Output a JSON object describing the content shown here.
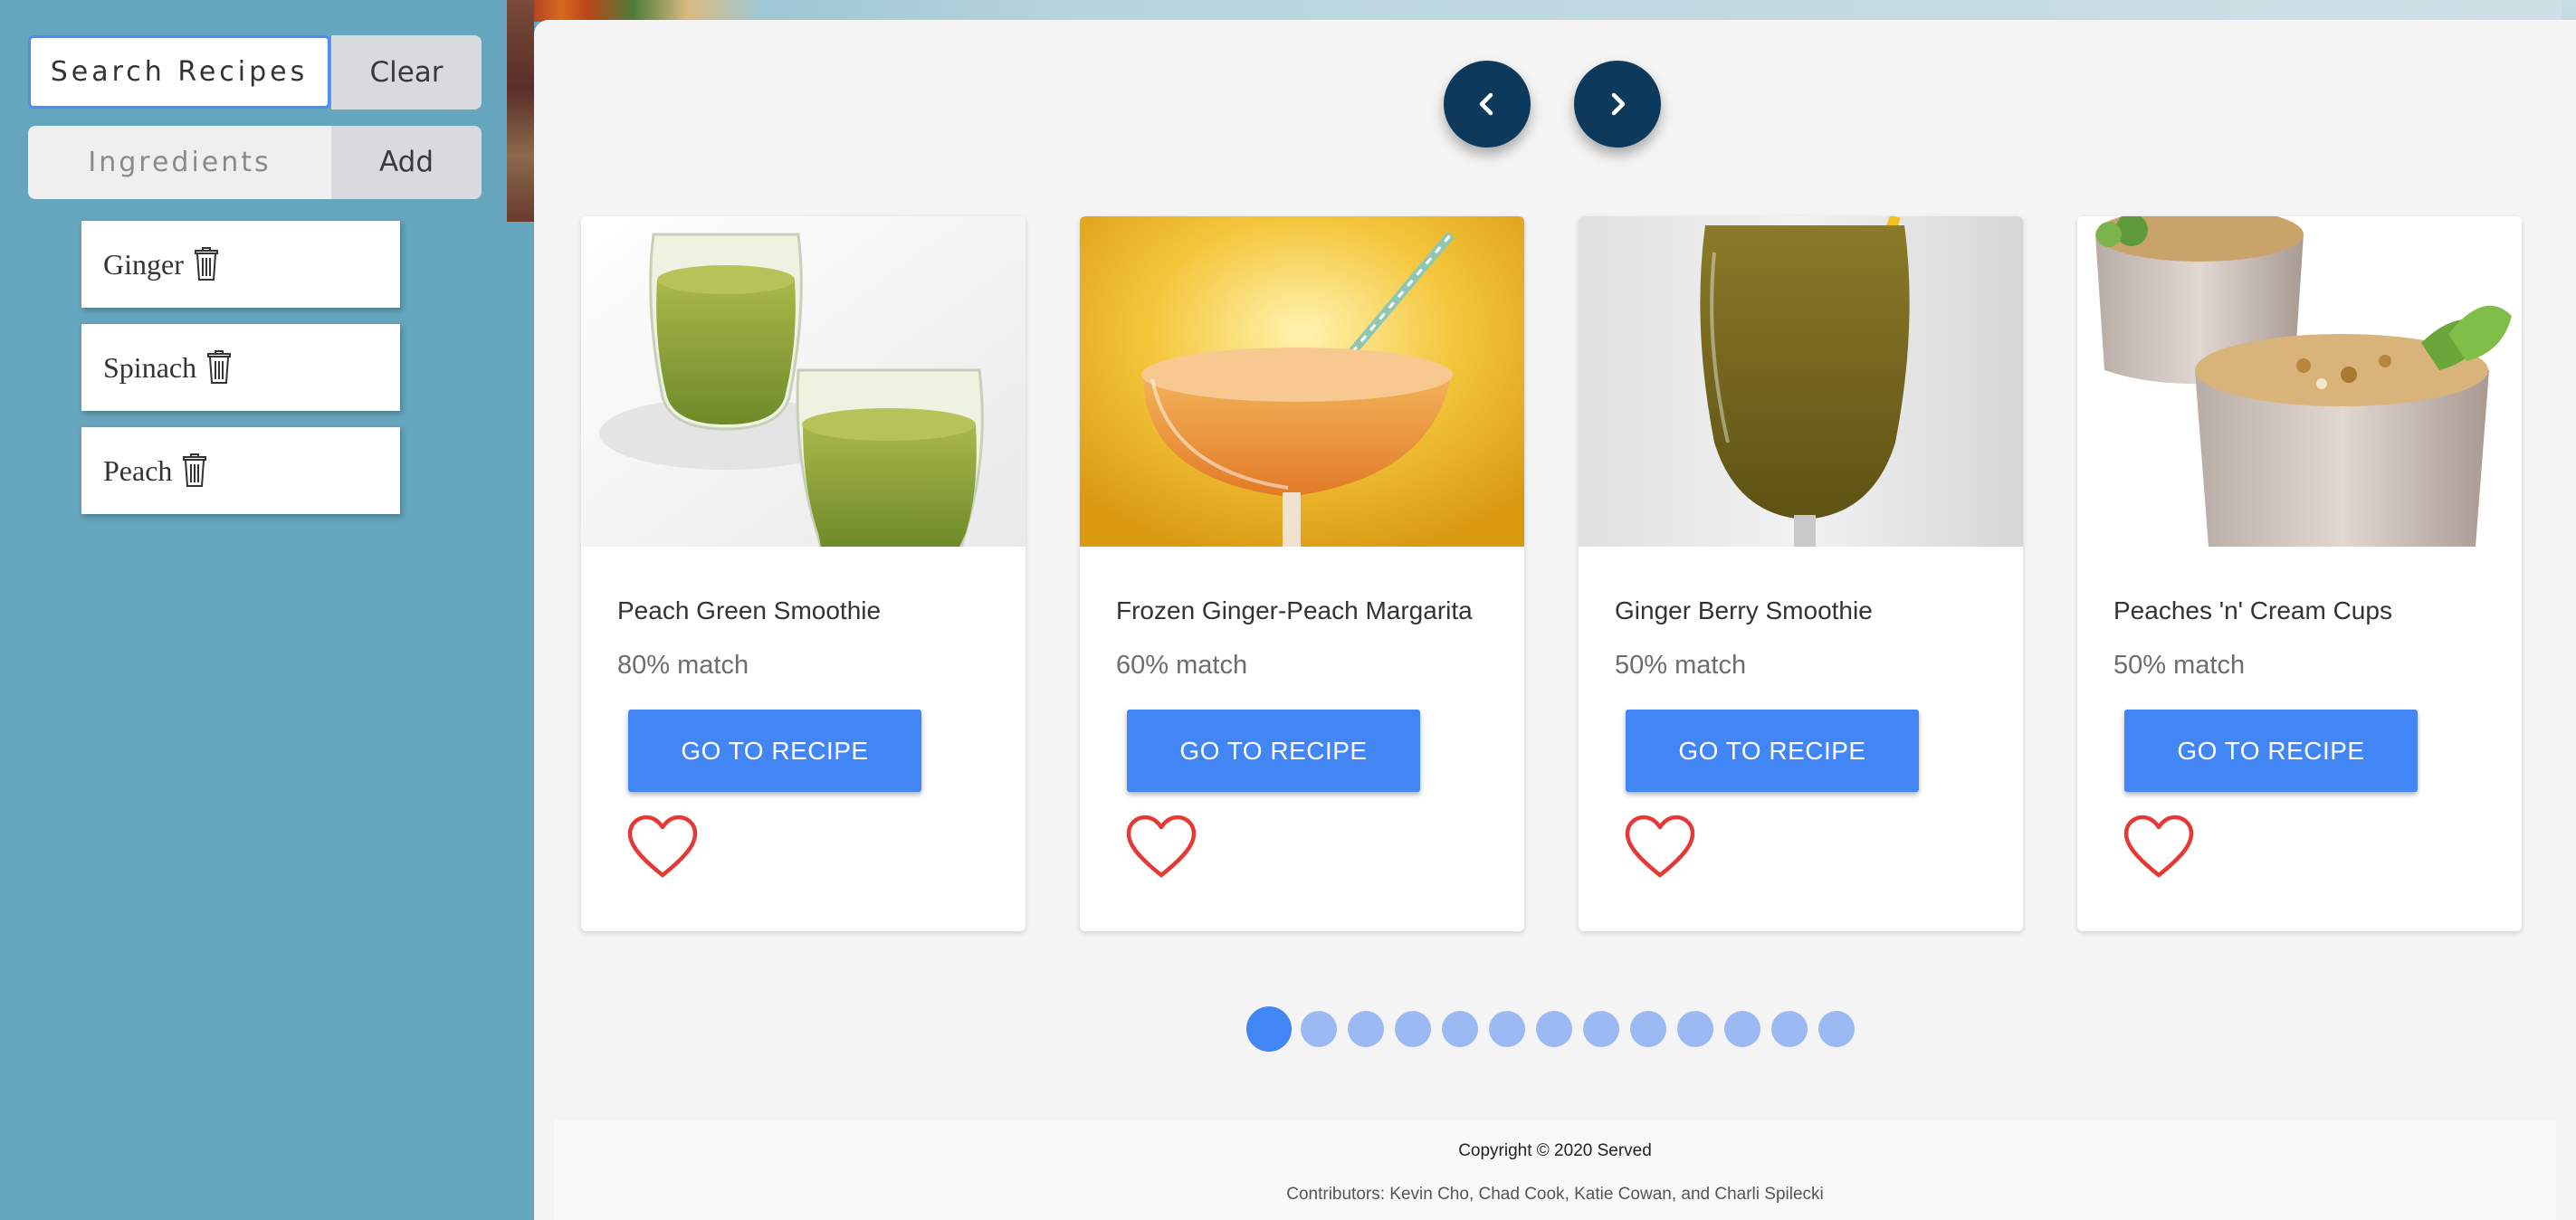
{
  "sidebar": {
    "search_label": "Search Recipes",
    "clear_label": "Clear",
    "ingredients_placeholder": "Ingredients",
    "add_label": "Add",
    "ingredients": [
      {
        "name": "Ginger"
      },
      {
        "name": "Spinach"
      },
      {
        "name": "Peach"
      }
    ]
  },
  "carousel": {
    "prev_icon": "chevron-left-icon",
    "next_icon": "chevron-right-icon",
    "cards": [
      {
        "title": "Peach Green Smoothie",
        "match": "80% match",
        "button": "GO TO RECIPE"
      },
      {
        "title": "Frozen Ginger-Peach Margarita",
        "match": "60% match",
        "button": "GO TO RECIPE"
      },
      {
        "title": "Ginger Berry Smoothie",
        "match": "50% match",
        "button": "GO TO RECIPE"
      },
      {
        "title": "Peaches 'n' Cream Cups",
        "match": "50% match",
        "button": "GO TO RECIPE"
      }
    ],
    "page_count": 13,
    "active_page": 1
  },
  "footer": {
    "copyright": "Copyright © 2020 Served",
    "contributors": "Contributors: Kevin Cho, Chad Cook, Katie Cowan, and Charli Spilecki"
  },
  "colors": {
    "sidebar": "#65a5bd",
    "nav_button": "#0d3a5c",
    "primary": "#4285f4",
    "heart": "#e53935"
  }
}
